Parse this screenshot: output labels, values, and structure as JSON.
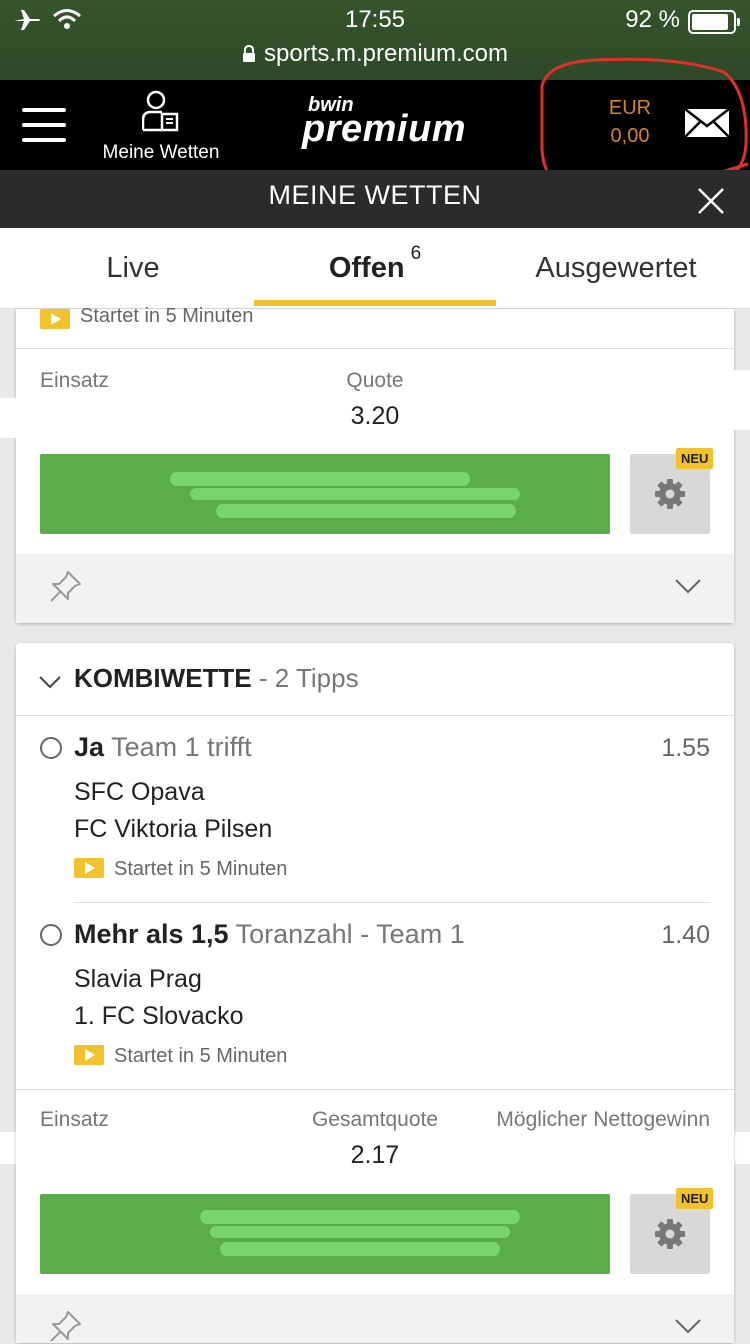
{
  "status_bar": {
    "time": "17:55",
    "url": "sports.m.premium.com",
    "battery": "92 %"
  },
  "header": {
    "my_bets_label": "Meine Wetten",
    "logo_top": "bwin",
    "logo_bottom": "premium",
    "currency": "EUR",
    "balance": "0,00"
  },
  "title_bar": {
    "title": "MEINE WETTEN"
  },
  "tabs": [
    {
      "label": "Live"
    },
    {
      "label": "Offen",
      "count": "6"
    },
    {
      "label": "Ausgewertet"
    }
  ],
  "bet1": {
    "starts_text": "Startet in 5 Minuten",
    "stake_label": "Einsatz",
    "odds_label": "Quote",
    "odds_value": "3.20",
    "new_badge": "NEU"
  },
  "bet2": {
    "type_label": "KOMBIWETTE",
    "tips_suffix": "- 2 Tipps",
    "tips": [
      {
        "selection": "Ja",
        "market": "Team 1 trifft",
        "odds": "1.55",
        "team1": "SFC Opava",
        "team2": "FC Viktoria Pilsen",
        "starts_text": "Startet in 5 Minuten"
      },
      {
        "selection": "Mehr als 1,5",
        "market": "Toranzahl - Team 1",
        "odds": "1.40",
        "team1": "Slavia Prag",
        "team2": "1. FC Slovacko",
        "starts_text": "Startet in 5 Minuten"
      }
    ],
    "stake_label": "Einsatz",
    "total_odds_label": "Gesamtquote",
    "total_odds_value": "2.17",
    "possible_win_label": "Möglicher Nettogewinn",
    "new_badge": "NEU"
  },
  "colors": {
    "accent_yellow": "#f2c12e",
    "button_green": "#5aad4a",
    "balance_orange": "#d9821e",
    "header_black": "#000000",
    "title_bar": "#2b2b2b"
  },
  "icons": [
    "airplane-icon",
    "wifi-icon",
    "lock-icon",
    "battery-icon",
    "hamburger-icon",
    "my-bets-icon",
    "mail-icon",
    "close-icon",
    "play-icon",
    "gear-icon",
    "pin-icon",
    "chevron-down-icon",
    "radio-icon"
  ]
}
